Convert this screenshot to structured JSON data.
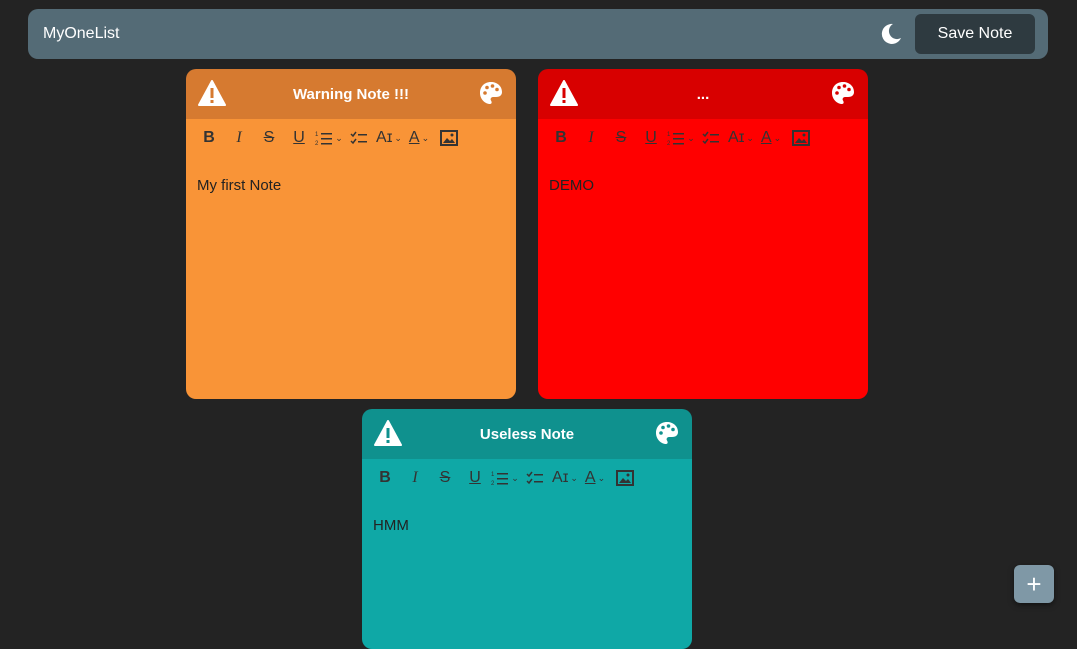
{
  "navbar": {
    "brand": "MyOneList",
    "theme_icon": "moon-icon",
    "save_label": "Save Note"
  },
  "toolbar_icons": [
    "bold-icon",
    "italic-icon",
    "strikethrough-icon",
    "underline-icon",
    "ordered-list-icon",
    "checklist-icon",
    "font-size-icon",
    "font-color-icon",
    "image-icon"
  ],
  "notes": [
    {
      "title": "Warning Note !!!",
      "body": "My first Note",
      "header_color": "#d67a30",
      "body_color": "#f99437"
    },
    {
      "title": "...",
      "body": "DEMO",
      "header_color": "#d80000",
      "body_color": "#ff0000"
    },
    {
      "title": "Useless Note",
      "body": "HMM",
      "header_color": "#0f918e",
      "body_color": "#0fa8a6"
    }
  ],
  "fab_label": "+"
}
